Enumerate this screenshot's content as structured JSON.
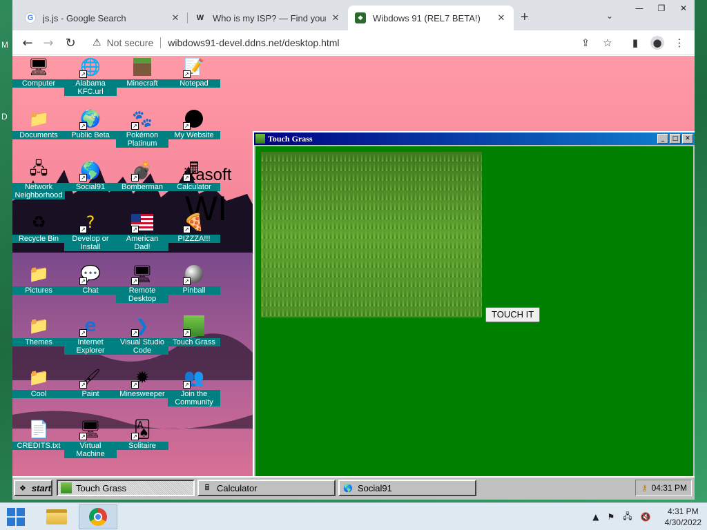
{
  "host": {
    "side_glyph_1": "M",
    "side_glyph_2": "D",
    "clock_time": "4:31 PM",
    "clock_date": "4/30/2022"
  },
  "browser": {
    "tabs": [
      {
        "title": "js.js - Google Search",
        "icon": "google-g-icon"
      },
      {
        "title": "Who is my ISP? — Find your Internet Service Provider",
        "icon": "w-logo-icon"
      },
      {
        "title": "Wibdows 91 (REL7 BETA!)",
        "icon": "wibdows-favicon"
      }
    ],
    "address": {
      "security_label": "Not secure",
      "url": "wibdows91-devel.ddns.net/desktop.html"
    }
  },
  "desktop": {
    "wallpaper_text_1": "ikasoft",
    "wallpaper_text_2": "WI",
    "icons": [
      {
        "label": "Computer",
        "icon": "computer-icon",
        "shortcut": false
      },
      {
        "label": "Alabama KFC.url",
        "icon": "internet-shortcut-icon",
        "shortcut": true
      },
      {
        "label": "Minecraft",
        "icon": "minecraft-icon",
        "shortcut": false
      },
      {
        "label": "Notepad",
        "icon": "notepad-icon",
        "shortcut": true
      },
      {
        "label": "Documents",
        "icon": "folder-icon",
        "shortcut": false
      },
      {
        "label": "Public Beta",
        "icon": "globe-icon",
        "shortcut": true
      },
      {
        "label": "Pokémon Platinum",
        "icon": "pokemon-icon",
        "shortcut": true
      },
      {
        "label": "My Website",
        "icon": "github-icon",
        "shortcut": true
      },
      {
        "label": "Network Neighborhood",
        "icon": "network-icon",
        "shortcut": false
      },
      {
        "label": "Social91",
        "icon": "globe-icon",
        "shortcut": true
      },
      {
        "label": "Bomberman",
        "icon": "bomberman-icon",
        "shortcut": true
      },
      {
        "label": "Calculator",
        "icon": "calculator-icon",
        "shortcut": true
      },
      {
        "label": "Recycle Bin",
        "icon": "recycle-bin-icon",
        "shortcut": false
      },
      {
        "label": "Develop or Install",
        "icon": "help-icon",
        "shortcut": true
      },
      {
        "label": "American Dad!",
        "icon": "us-flag-icon",
        "shortcut": true
      },
      {
        "label": "PIZZZA!!!",
        "icon": "pizza-icon",
        "shortcut": true
      },
      {
        "label": "Pictures",
        "icon": "folder-icon",
        "shortcut": false
      },
      {
        "label": "Chat",
        "icon": "chat-icon",
        "shortcut": true
      },
      {
        "label": "Remote Desktop",
        "icon": "remote-desktop-icon",
        "shortcut": true
      },
      {
        "label": "Pinball",
        "icon": "pinball-icon",
        "shortcut": true
      },
      {
        "label": "Themes",
        "icon": "folder-icon",
        "shortcut": false
      },
      {
        "label": "Internet Explorer",
        "icon": "internet-explorer-icon",
        "shortcut": true
      },
      {
        "label": "Visual Studio Code",
        "icon": "vscode-icon",
        "shortcut": true
      },
      {
        "label": "Touch Grass",
        "icon": "grass-icon",
        "shortcut": true
      },
      {
        "label": "Cool",
        "icon": "folder-icon",
        "shortcut": false
      },
      {
        "label": "Paint",
        "icon": "paint-icon",
        "shortcut": true
      },
      {
        "label": "Minesweeper",
        "icon": "mine-icon",
        "shortcut": true
      },
      {
        "label": "Join the Community",
        "icon": "community-icon",
        "shortcut": true
      },
      {
        "label": "CREDITS.txt",
        "icon": "text-file-icon",
        "shortcut": false
      },
      {
        "label": "Virtual Machine",
        "icon": "computer-icon",
        "shortcut": true
      },
      {
        "label": "Solitaire",
        "icon": "solitaire-icon",
        "shortcut": true
      }
    ]
  },
  "touch_grass_window": {
    "title": "Touch Grass",
    "button_label": "TOUCH IT"
  },
  "wibdows_taskbar": {
    "start_label": "start",
    "tasks": [
      {
        "label": "Touch Grass",
        "icon": "grass-icon",
        "active": true
      },
      {
        "label": "Calculator",
        "icon": "calculator-icon",
        "active": false
      },
      {
        "label": "Social91",
        "icon": "globe-icon",
        "active": false
      }
    ],
    "clock": "04:31 PM"
  }
}
